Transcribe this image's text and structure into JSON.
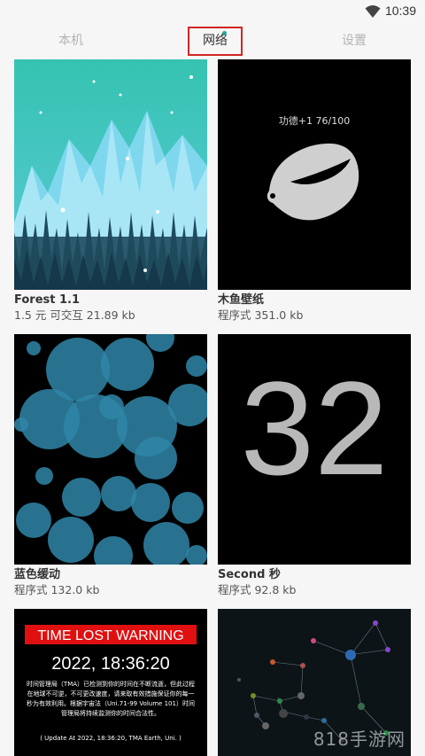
{
  "status_bar": {
    "time": "10:39",
    "wifi_icon": "wifi-icon"
  },
  "tabs": [
    {
      "label": "本机"
    },
    {
      "label": "网络"
    },
    {
      "label": "设置"
    }
  ],
  "cards": [
    {
      "title": "Forest 1.1",
      "meta": "1.5 元 可交互  21.89 kb"
    },
    {
      "title": "木鱼壁纸",
      "meta": "程序式  351.0 kb",
      "thumb_text": "功德+1 76/100"
    },
    {
      "title": "蓝色缓动",
      "meta": "程序式  132.0 kb"
    },
    {
      "title": "Second 秒",
      "meta": "程序式  92.8 kb",
      "thumb_text": "32"
    },
    {
      "title": "",
      "meta": "",
      "thumb_banner": "TIME LOST WARNING",
      "thumb_datetime": "2022, 18:36:20",
      "thumb_body": "时间管理局（TMA）已检测到你的时间在不断流逝，但此过程在地球不可逆，不可更改速度，请来取有效措施保证你的每一秒为有效利用。根据宇宙法（Uni.71-99 Volume 101）时间管理局将持续监测你的时间合法性。",
      "thumb_footer": "( Update At 2022, 18:36:20, TMA Earth, Uni. )"
    },
    {
      "title": "",
      "meta": ""
    }
  ],
  "watermark": "818手游网",
  "colors": {
    "accent": "#d32424",
    "notify_dot": "#26a69a"
  }
}
